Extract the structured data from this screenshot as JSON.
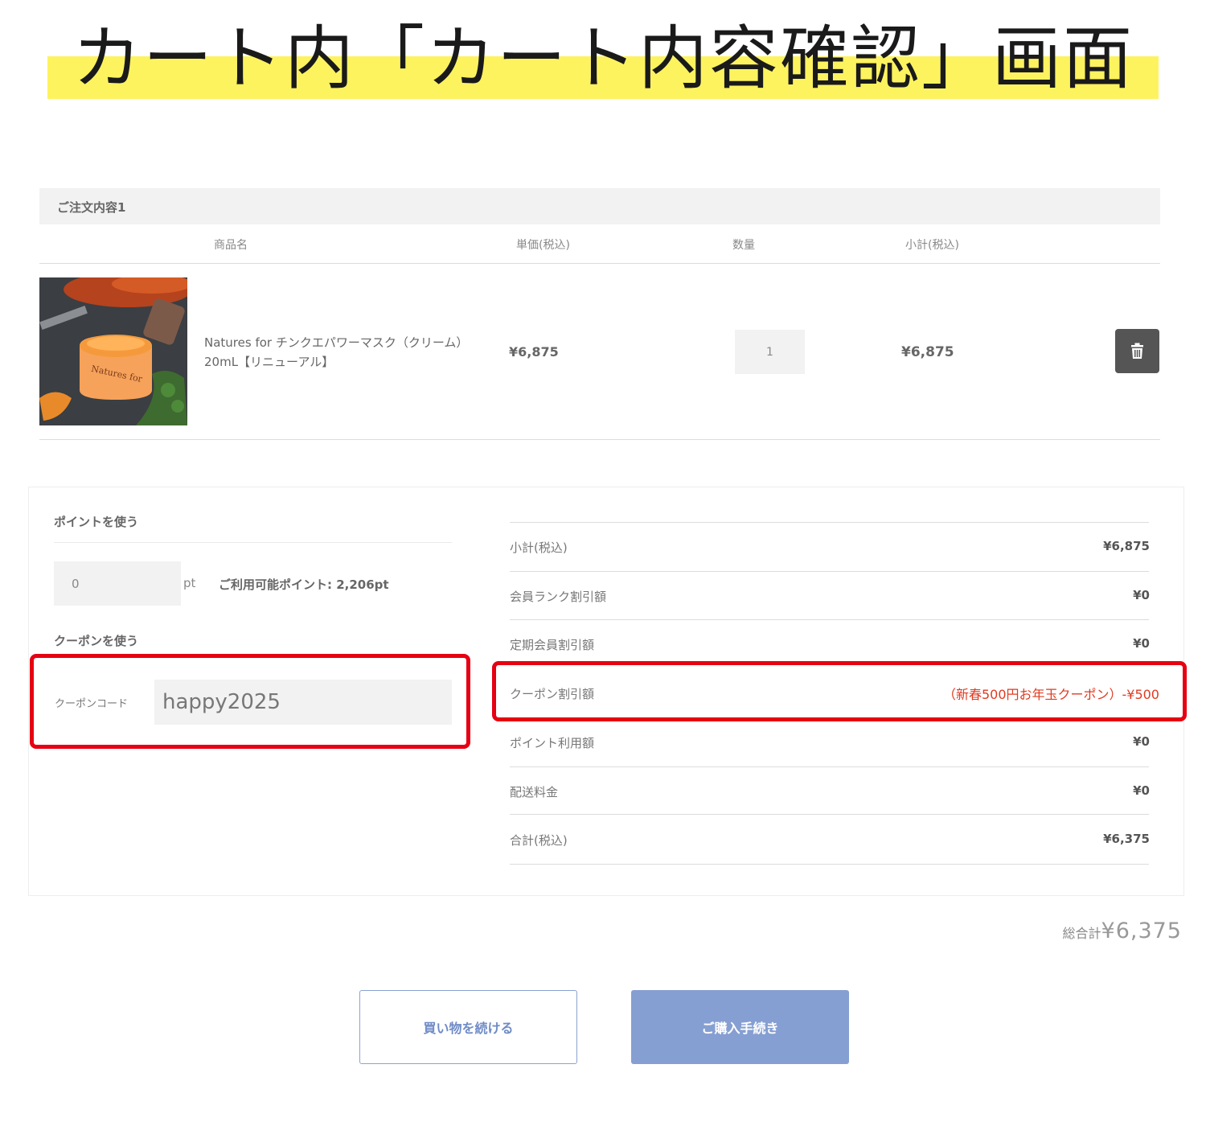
{
  "banner": {
    "title": "カート内「カート内容確認」画面"
  },
  "order": {
    "header": "ご注文内容1",
    "columns": {
      "name": "商品名",
      "unit_price": "単価(税込)",
      "quantity": "数量",
      "subtotal": "小計(税込)"
    },
    "items": [
      {
        "name_line1": "Natures for チンクエパワーマスク（クリーム）",
        "name_line2": "20mL【リニューアル】",
        "unit_price": "¥6,875",
        "quantity": "1",
        "subtotal": "¥6,875",
        "image_icon": "product-jar-image"
      }
    ]
  },
  "points": {
    "title": "ポイントを使う",
    "value": "0",
    "unit": "pt",
    "available": "ご利用可能ポイント: 2,206pt"
  },
  "coupon": {
    "title": "クーポンを使う",
    "label": "クーポンコード",
    "value": "happy2025"
  },
  "summary": {
    "subtotal_label": "小計(税込)",
    "subtotal_value": "¥6,875",
    "member_rank_label": "会員ランク割引額",
    "member_rank_value": "¥0",
    "regular_member_label": "定期会員割引額",
    "regular_member_value": "¥0",
    "coupon_label": "クーポン割引額",
    "coupon_value": "（新春500円お年玉クーポン）-¥500",
    "point_use_label": "ポイント利用額",
    "point_use_value": "¥0",
    "shipping_label": "配送料金",
    "shipping_value": "¥0",
    "total_label": "合計(税込)",
    "total_value": "¥6,375"
  },
  "grand_total": {
    "label": "総合計",
    "value": "¥6,375"
  },
  "buttons": {
    "continue": "買い物を続ける",
    "purchase": "ご購入手続き"
  },
  "colors": {
    "highlight": "#fdf35f",
    "accent": "#869fd2",
    "annotation": "#e60012",
    "discount": "#e03a20"
  }
}
